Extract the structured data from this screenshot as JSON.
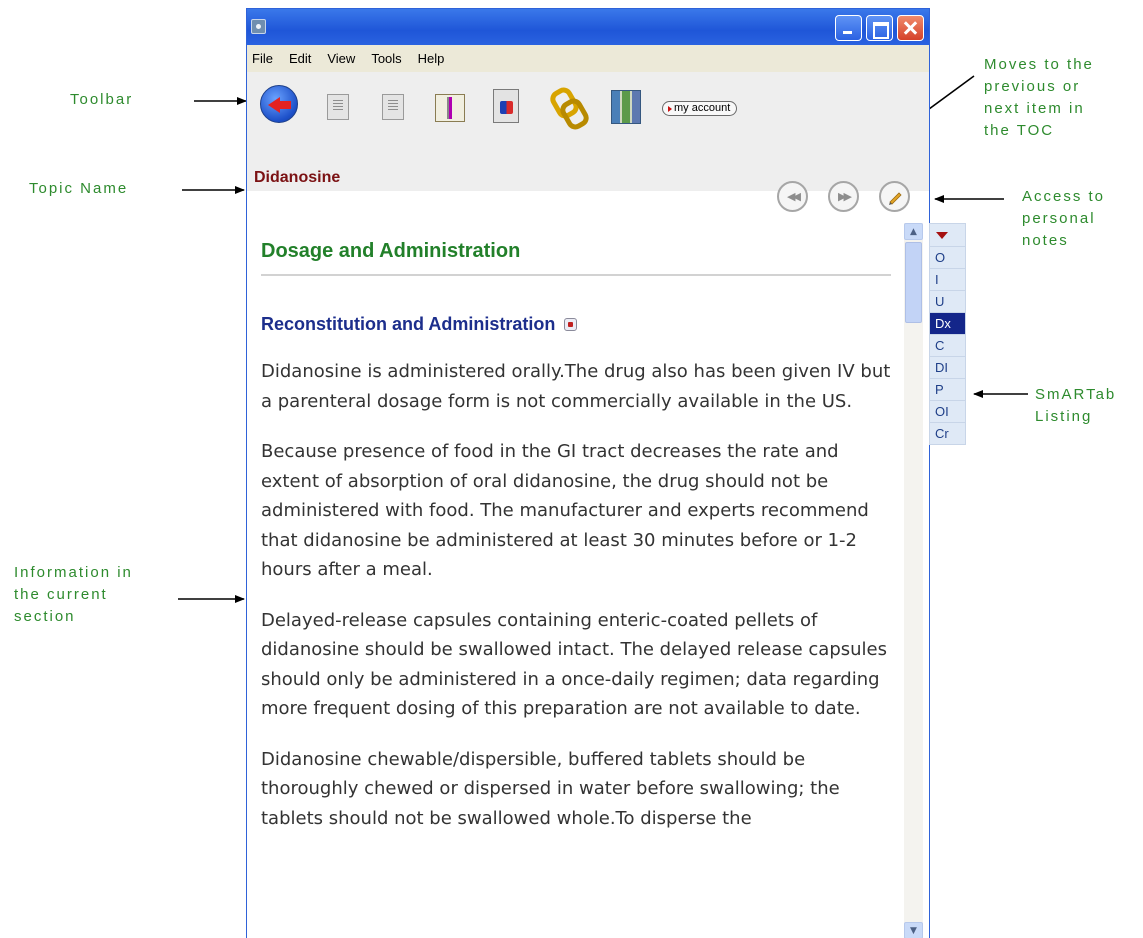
{
  "annotations": {
    "toolbar": "Toolbar",
    "topic_name": "Topic Name",
    "toc_nav": "Moves to the\nprevious or\nnext item in\nthe TOC",
    "notes": "Access to\npersonal\nnotes",
    "smartab": "SmARTab\nListing",
    "info": "Information in\nthe current\nsection"
  },
  "menu": {
    "items": [
      "File",
      "Edit",
      "View",
      "Tools",
      "Help"
    ]
  },
  "toolbar": {
    "account_label": "my account",
    "icons": [
      "back-arrow-icon",
      "document-icon",
      "list-document-icon",
      "book-icon",
      "print-document-icon",
      "link-icon",
      "library-books-icon"
    ]
  },
  "topic": {
    "name": "Didanosine"
  },
  "content": {
    "heading": "Dosage and Administration",
    "subheading": "Reconstitution and Administration",
    "paragraphs": [
      "Didanosine is administered orally.The drug also has been given IV  but a parenteral dosage form is not commercially available in the US.",
      "Because presence of food in the GI tract decreases the rate and extent of absorption of oral didanosine, the drug should not be administered with food. The manufacturer and experts recommend that didanosine be administered at least 30 minutes before or 1-2 hours after a meal.",
      "Delayed-release capsules containing enteric-coated pellets of didanosine should be swallowed intact. The delayed release capsules should only be administered in a once-daily regimen; data regarding more frequent dosing of this preparation are not available to date.",
      "Didanosine chewable/dispersible, buffered tablets should be thoroughly chewed or dispersed in water before swallowing; the tablets should not be swallowed whole.To disperse the"
    ]
  },
  "smartab": {
    "tabs": [
      "O",
      "I",
      "U",
      "Dx",
      "C",
      "DI",
      "P",
      "OI",
      "Cr"
    ],
    "active": "Dx"
  },
  "colors": {
    "annotation": "#2e8b2e",
    "titlebar": "#2158de",
    "topic_name": "#7b1113",
    "heading": "#22802a",
    "subheading": "#1c2e8c",
    "active_tab": "#14268a"
  }
}
